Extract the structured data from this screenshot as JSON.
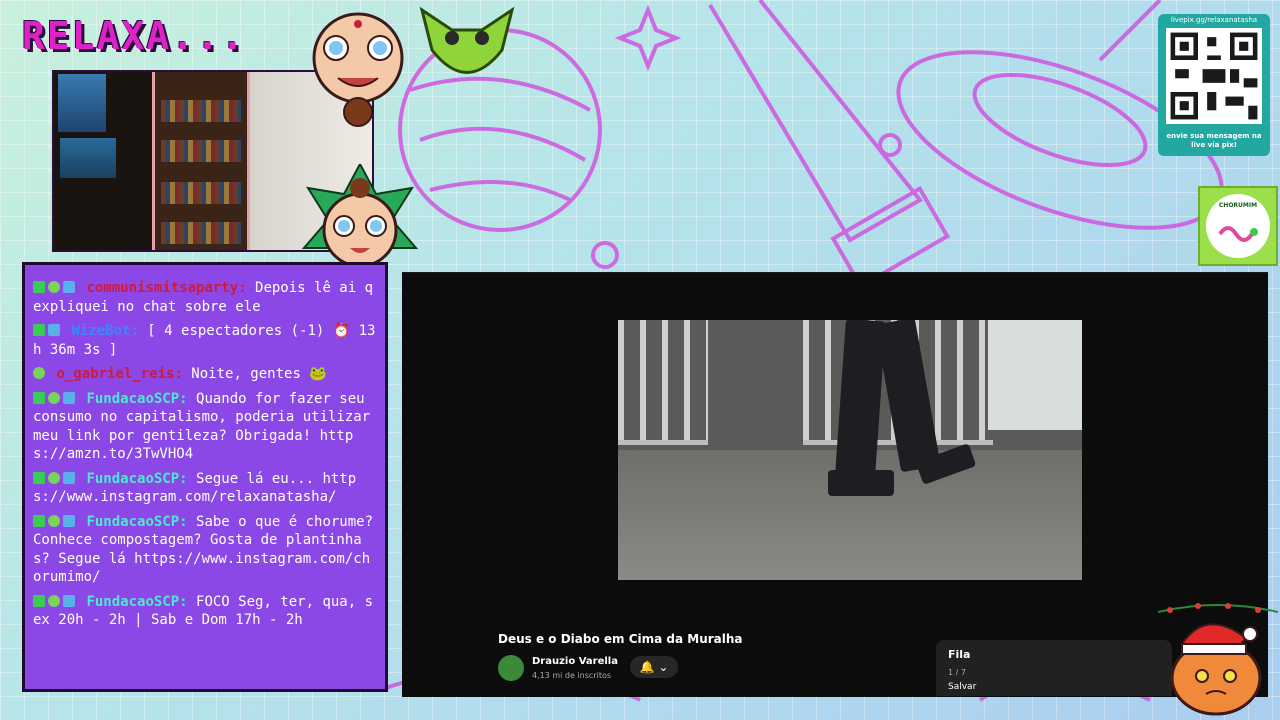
{
  "overlay": {
    "title": "RELAXA...",
    "qr_url": "livepix.gg/relaxanatasha",
    "qr_caption": "envie sua mensagem na live via pix!",
    "chorume_label": "CHORUMIM"
  },
  "chat": {
    "messages": [
      {
        "user": "communismitsaparty:",
        "text": " Depois lê ai q expliquei no chat sobre ele"
      },
      {
        "user": "WizeBot:",
        "text": " [ 4 espectadores (-1) ⏰ 13h 36m 3s ]"
      },
      {
        "user": "o_gabriel_reis:",
        "text": " Noite, gentes 🐸"
      },
      {
        "user": "FundacaoSCP:",
        "text": " Quando for fazer seu consumo no capitalismo, poderia utilizar meu link por gentileza? Obrigada! https://amzn.to/3TwVHO4"
      },
      {
        "user": "FundacaoSCP:",
        "text": " Segue lá eu... https://www.instagram.com/relaxanatasha/"
      },
      {
        "user": "FundacaoSCP:",
        "text": " Sabe o que é chorume? Conhece compostagem? Gosta de plantinhas? Segue lá https://www.instagram.com/chorumimo/"
      },
      {
        "user": "FundacaoSCP:",
        "text": " FOCO Seg, ter, qua, sex 20h - 2h | Sab e Dom 17h - 2h"
      }
    ]
  },
  "player": {
    "video_title": "Deus e o Diabo em Cima da Muralha",
    "channel_name": "Drauzio Varella",
    "channel_subs": "4,13 mi de inscritos",
    "bell_label": "🔔 ⌄",
    "queue_title": "Fila",
    "queue_count": "1 / 7",
    "queue_save": "Salvar"
  },
  "colors": {
    "chat_bg": "#8b48e6",
    "title_pink": "#e020c8",
    "player_bg": "#0c0c0c"
  }
}
